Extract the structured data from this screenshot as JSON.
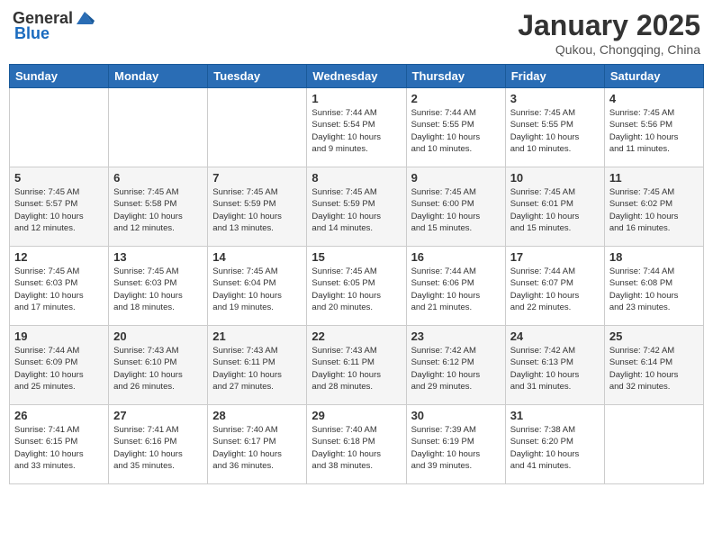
{
  "header": {
    "logo_general": "General",
    "logo_blue": "Blue",
    "month_title": "January 2025",
    "location": "Qukou, Chongqing, China"
  },
  "days_of_week": [
    "Sunday",
    "Monday",
    "Tuesday",
    "Wednesday",
    "Thursday",
    "Friday",
    "Saturday"
  ],
  "weeks": [
    [
      {
        "day": "",
        "info": ""
      },
      {
        "day": "",
        "info": ""
      },
      {
        "day": "",
        "info": ""
      },
      {
        "day": "1",
        "info": "Sunrise: 7:44 AM\nSunset: 5:54 PM\nDaylight: 10 hours\nand 9 minutes."
      },
      {
        "day": "2",
        "info": "Sunrise: 7:44 AM\nSunset: 5:55 PM\nDaylight: 10 hours\nand 10 minutes."
      },
      {
        "day": "3",
        "info": "Sunrise: 7:45 AM\nSunset: 5:55 PM\nDaylight: 10 hours\nand 10 minutes."
      },
      {
        "day": "4",
        "info": "Sunrise: 7:45 AM\nSunset: 5:56 PM\nDaylight: 10 hours\nand 11 minutes."
      }
    ],
    [
      {
        "day": "5",
        "info": "Sunrise: 7:45 AM\nSunset: 5:57 PM\nDaylight: 10 hours\nand 12 minutes."
      },
      {
        "day": "6",
        "info": "Sunrise: 7:45 AM\nSunset: 5:58 PM\nDaylight: 10 hours\nand 12 minutes."
      },
      {
        "day": "7",
        "info": "Sunrise: 7:45 AM\nSunset: 5:59 PM\nDaylight: 10 hours\nand 13 minutes."
      },
      {
        "day": "8",
        "info": "Sunrise: 7:45 AM\nSunset: 5:59 PM\nDaylight: 10 hours\nand 14 minutes."
      },
      {
        "day": "9",
        "info": "Sunrise: 7:45 AM\nSunset: 6:00 PM\nDaylight: 10 hours\nand 15 minutes."
      },
      {
        "day": "10",
        "info": "Sunrise: 7:45 AM\nSunset: 6:01 PM\nDaylight: 10 hours\nand 15 minutes."
      },
      {
        "day": "11",
        "info": "Sunrise: 7:45 AM\nSunset: 6:02 PM\nDaylight: 10 hours\nand 16 minutes."
      }
    ],
    [
      {
        "day": "12",
        "info": "Sunrise: 7:45 AM\nSunset: 6:03 PM\nDaylight: 10 hours\nand 17 minutes."
      },
      {
        "day": "13",
        "info": "Sunrise: 7:45 AM\nSunset: 6:03 PM\nDaylight: 10 hours\nand 18 minutes."
      },
      {
        "day": "14",
        "info": "Sunrise: 7:45 AM\nSunset: 6:04 PM\nDaylight: 10 hours\nand 19 minutes."
      },
      {
        "day": "15",
        "info": "Sunrise: 7:45 AM\nSunset: 6:05 PM\nDaylight: 10 hours\nand 20 minutes."
      },
      {
        "day": "16",
        "info": "Sunrise: 7:44 AM\nSunset: 6:06 PM\nDaylight: 10 hours\nand 21 minutes."
      },
      {
        "day": "17",
        "info": "Sunrise: 7:44 AM\nSunset: 6:07 PM\nDaylight: 10 hours\nand 22 minutes."
      },
      {
        "day": "18",
        "info": "Sunrise: 7:44 AM\nSunset: 6:08 PM\nDaylight: 10 hours\nand 23 minutes."
      }
    ],
    [
      {
        "day": "19",
        "info": "Sunrise: 7:44 AM\nSunset: 6:09 PM\nDaylight: 10 hours\nand 25 minutes."
      },
      {
        "day": "20",
        "info": "Sunrise: 7:43 AM\nSunset: 6:10 PM\nDaylight: 10 hours\nand 26 minutes."
      },
      {
        "day": "21",
        "info": "Sunrise: 7:43 AM\nSunset: 6:11 PM\nDaylight: 10 hours\nand 27 minutes."
      },
      {
        "day": "22",
        "info": "Sunrise: 7:43 AM\nSunset: 6:11 PM\nDaylight: 10 hours\nand 28 minutes."
      },
      {
        "day": "23",
        "info": "Sunrise: 7:42 AM\nSunset: 6:12 PM\nDaylight: 10 hours\nand 29 minutes."
      },
      {
        "day": "24",
        "info": "Sunrise: 7:42 AM\nSunset: 6:13 PM\nDaylight: 10 hours\nand 31 minutes."
      },
      {
        "day": "25",
        "info": "Sunrise: 7:42 AM\nSunset: 6:14 PM\nDaylight: 10 hours\nand 32 minutes."
      }
    ],
    [
      {
        "day": "26",
        "info": "Sunrise: 7:41 AM\nSunset: 6:15 PM\nDaylight: 10 hours\nand 33 minutes."
      },
      {
        "day": "27",
        "info": "Sunrise: 7:41 AM\nSunset: 6:16 PM\nDaylight: 10 hours\nand 35 minutes."
      },
      {
        "day": "28",
        "info": "Sunrise: 7:40 AM\nSunset: 6:17 PM\nDaylight: 10 hours\nand 36 minutes."
      },
      {
        "day": "29",
        "info": "Sunrise: 7:40 AM\nSunset: 6:18 PM\nDaylight: 10 hours\nand 38 minutes."
      },
      {
        "day": "30",
        "info": "Sunrise: 7:39 AM\nSunset: 6:19 PM\nDaylight: 10 hours\nand 39 minutes."
      },
      {
        "day": "31",
        "info": "Sunrise: 7:38 AM\nSunset: 6:20 PM\nDaylight: 10 hours\nand 41 minutes."
      },
      {
        "day": "",
        "info": ""
      }
    ]
  ]
}
